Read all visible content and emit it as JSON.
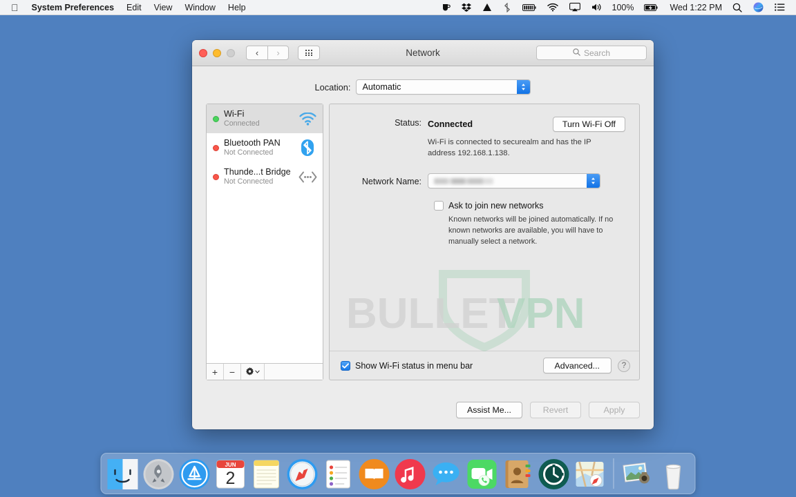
{
  "menubar": {
    "apple_icon": "apple-logo",
    "items": [
      {
        "label": "System Preferences",
        "bold": true
      },
      {
        "label": "Edit",
        "bold": false
      },
      {
        "label": "View",
        "bold": false
      },
      {
        "label": "Window",
        "bold": false
      },
      {
        "label": "Help",
        "bold": false
      }
    ],
    "status_icons": [
      "coffee-cup-icon",
      "dropbox-icon",
      "google-drive-icon",
      "bluetooth-share-icon",
      "battery-level-icon",
      "wifi-icon",
      "airplay-icon",
      "volume-icon"
    ],
    "battery_percent": "100%",
    "clock": "Wed 1:22 PM",
    "right_icons": [
      "spotlight-search-icon",
      "siri-icon",
      "notification-center-icon"
    ]
  },
  "window": {
    "title": "Network",
    "traffic_lights": [
      "close",
      "minimize",
      "zoom-disabled"
    ],
    "back_label": "‹",
    "forward_label": "›",
    "grid_icon": "show-all-grid-icon",
    "search": {
      "placeholder": "Search",
      "value": "",
      "icon": "search-icon"
    }
  },
  "location": {
    "label": "Location:",
    "selected": "Automatic"
  },
  "sidebar": {
    "interfaces": [
      {
        "name": "Wi-Fi",
        "status": "Connected",
        "dot": "green",
        "icon": "wifi-icon",
        "selected": true
      },
      {
        "name": "Bluetooth PAN",
        "status": "Not Connected",
        "dot": "red",
        "icon": "bluetooth-icon",
        "selected": false
      },
      {
        "name": "Thunde...t Bridge",
        "status": "Not Connected",
        "dot": "red",
        "icon": "thunderbolt-bridge-icon",
        "selected": false
      }
    ],
    "toolbar": {
      "add_label": "+",
      "remove_label": "−",
      "gear_icon": "gear-icon",
      "gear_chevron": "chevron-down-icon"
    }
  },
  "detail": {
    "status_label": "Status:",
    "status_value": "Connected",
    "turn_wifi_off_label": "Turn Wi-Fi Off",
    "status_description": "Wi-Fi is connected to securealm and has the IP address 192.168.1.138.",
    "network_name_label": "Network Name:",
    "network_name_value": "",
    "network_name_redacted": true,
    "ask_join_label": "Ask to join new networks",
    "ask_join_checked": false,
    "ask_join_description": "Known networks will be joined automatically. If no known networks are available, you will have to manually select a network.",
    "show_status_label": "Show Wi-Fi status in menu bar",
    "show_status_checked": true,
    "advanced_label": "Advanced...",
    "help_label": "?"
  },
  "footer": {
    "assist_label": "Assist Me...",
    "revert_label": "Revert",
    "revert_enabled": false,
    "apply_label": "Apply",
    "apply_enabled": false
  },
  "watermark": {
    "text_primary": "BULLET",
    "text_accent": "VPN",
    "accent_color": "#7fc49a",
    "primary_color": "#b9b9b9"
  },
  "dock": {
    "icons": [
      {
        "name": "finder-icon"
      },
      {
        "name": "launchpad-icon"
      },
      {
        "name": "app-store-icon"
      },
      {
        "name": "calendar-icon",
        "month": "JUN",
        "day": "2"
      },
      {
        "name": "notes-icon"
      },
      {
        "name": "safari-icon"
      },
      {
        "name": "reminders-icon"
      },
      {
        "name": "ibooks-icon"
      },
      {
        "name": "itunes-icon"
      },
      {
        "name": "messages-icon"
      },
      {
        "name": "facetime-icon"
      },
      {
        "name": "contacts-icon"
      },
      {
        "name": "time-machine-icon"
      },
      {
        "name": "maps-icon"
      }
    ],
    "icons_right": [
      {
        "name": "photos-stack-icon"
      },
      {
        "name": "trash-icon"
      }
    ]
  },
  "colors": {
    "desktop": "#4f80bf",
    "window_bg": "#ececec",
    "accent_blue": "#1a7ae8"
  }
}
